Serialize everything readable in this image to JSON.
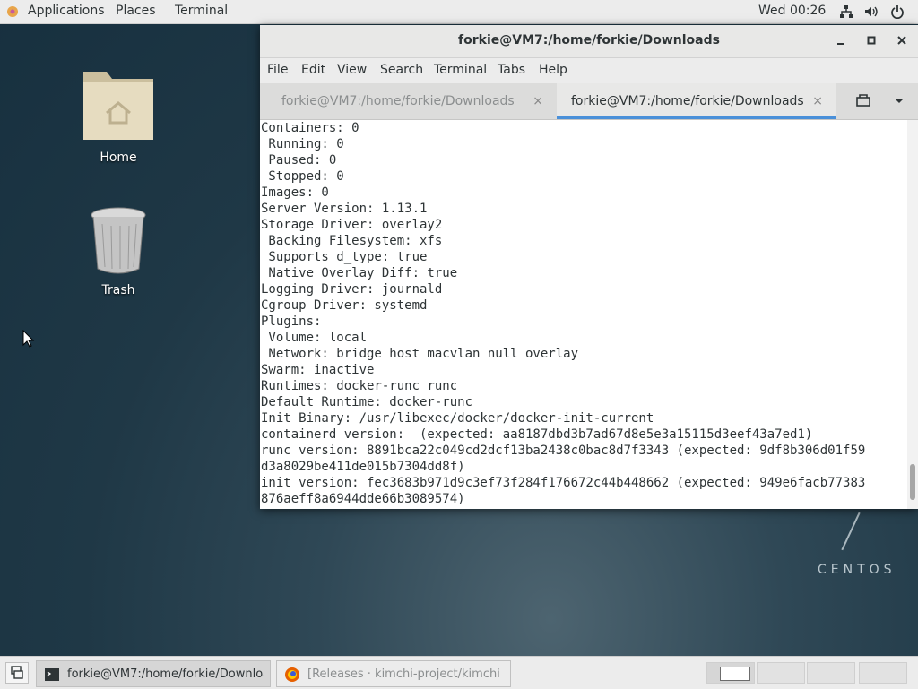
{
  "topbar": {
    "applications": "Applications",
    "places": "Places",
    "terminal": "Terminal",
    "clock": "Wed 00:26"
  },
  "desktop": {
    "home_label": "Home",
    "trash_label": "Trash",
    "brand": "CENTOS"
  },
  "window": {
    "title": "forkie@VM7:/home/forkie/Downloads",
    "menu": [
      "File",
      "Edit",
      "View",
      "Search",
      "Terminal",
      "Tabs",
      "Help"
    ],
    "tabs": [
      {
        "label": "forkie@VM7:/home/forkie/Downloads",
        "close": "×"
      },
      {
        "label": "forkie@VM7:/home/forkie/Downloads",
        "close": "×"
      }
    ],
    "lines": [
      "Containers: 0",
      " Running: 0",
      " Paused: 0",
      " Stopped: 0",
      "Images: 0",
      "Server Version: 1.13.1",
      "Storage Driver: overlay2",
      " Backing Filesystem: xfs",
      " Supports d_type: true",
      " Native Overlay Diff: true",
      "Logging Driver: journald",
      "Cgroup Driver: systemd",
      "Plugins:",
      " Volume: local",
      " Network: bridge host macvlan null overlay",
      "Swarm: inactive",
      "Runtimes: docker-runc runc",
      "Default Runtime: docker-runc",
      "Init Binary: /usr/libexec/docker/docker-init-current",
      "containerd version:  (expected: aa8187dbd3b7ad67d8e5e3a15115d3eef43a7ed1)",
      "runc version: 8891bca22c049cd2dcf13ba2438c0bac8d7f3343 (expected: 9df8b306d01f59",
      "d3a8029be411de015b7304dd8f)",
      "init version: fec3683b971d9c3ef73f284f176672c44b448662 (expected: 949e6facb77383",
      "876aeff8a6944dde66b3089574)"
    ]
  },
  "taskbar": {
    "task1": "forkie@VM7:/home/forkie/Downloa...",
    "task2": "[Releases · kimchi-project/kimchi · G..."
  }
}
